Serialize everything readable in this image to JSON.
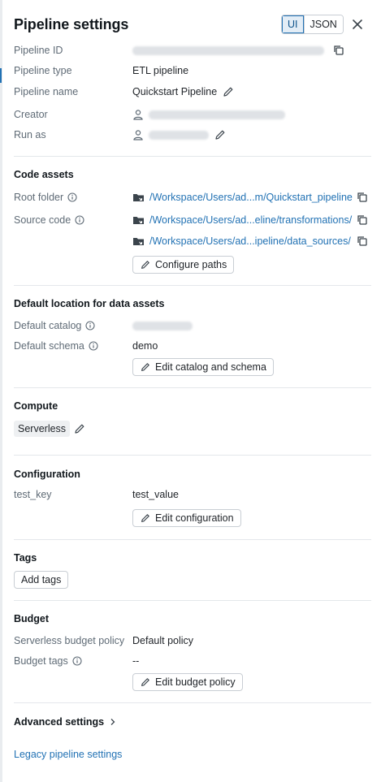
{
  "header": {
    "title": "Pipeline settings",
    "toggle": {
      "ui": "UI",
      "json": "JSON",
      "active": "UI"
    }
  },
  "details": {
    "pipeline_id_label": "Pipeline ID",
    "pipeline_type_label": "Pipeline type",
    "pipeline_type_value": "ETL pipeline",
    "pipeline_name_label": "Pipeline name",
    "pipeline_name_value": "Quickstart Pipeline",
    "creator_label": "Creator",
    "run_as_label": "Run as"
  },
  "code_assets": {
    "title": "Code assets",
    "root_folder_label": "Root folder",
    "root_folder_path": "/Workspace/Users/ad...m/Quickstart_pipeline",
    "source_code_label": "Source code",
    "source_paths": [
      "/Workspace/Users/ad...eline/transformations/",
      "/Workspace/Users/ad...ipeline/data_sources/"
    ],
    "configure_button": "Configure paths"
  },
  "default_location": {
    "title": "Default location for data assets",
    "catalog_label": "Default catalog",
    "schema_label": "Default schema",
    "schema_value": "demo",
    "edit_button": "Edit catalog and schema"
  },
  "compute": {
    "title": "Compute",
    "value": "Serverless"
  },
  "configuration": {
    "title": "Configuration",
    "key": "test_key",
    "value": "test_value",
    "edit_button": "Edit configuration"
  },
  "tags": {
    "title": "Tags",
    "add_button": "Add tags"
  },
  "budget": {
    "title": "Budget",
    "policy_label": "Serverless budget policy",
    "policy_value": "Default policy",
    "tags_label": "Budget tags",
    "tags_value": "--",
    "edit_button": "Edit budget policy"
  },
  "footer": {
    "advanced": "Advanced settings",
    "legacy": "Legacy pipeline settings"
  },
  "colors": {
    "accent": "#2272b4",
    "label": "#5f6b76",
    "text": "#1f2328"
  }
}
